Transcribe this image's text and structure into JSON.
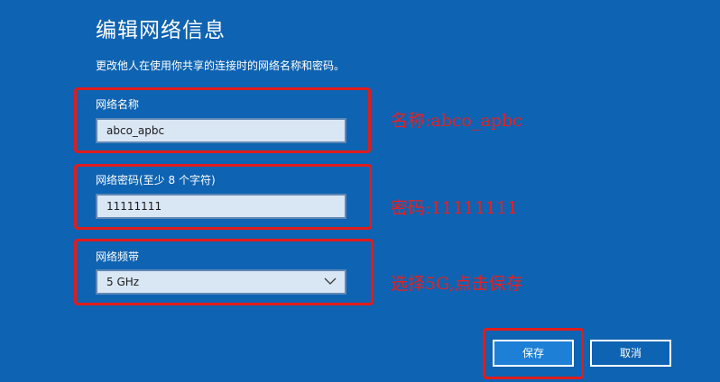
{
  "dialog": {
    "title": "编辑网络信息",
    "subtitle": "更改他人在使用你共享的连接时的网络名称和密码。"
  },
  "fields": {
    "name": {
      "label": "网络名称",
      "value": "abco_apbc"
    },
    "password": {
      "label": "网络密码(至少 8 个字符)",
      "value": "11111111"
    },
    "band": {
      "label": "网络频带",
      "value": "5 GHz"
    }
  },
  "annotations": {
    "name": "名称:abco_apbc",
    "password": "密码:11111111",
    "band": "选择5G,点击保存"
  },
  "buttons": {
    "save": "保存",
    "cancel": "取消"
  },
  "colors": {
    "background": "#0e63b2",
    "annotation": "#e21b1b",
    "primary_button": "#1e7fd6"
  }
}
